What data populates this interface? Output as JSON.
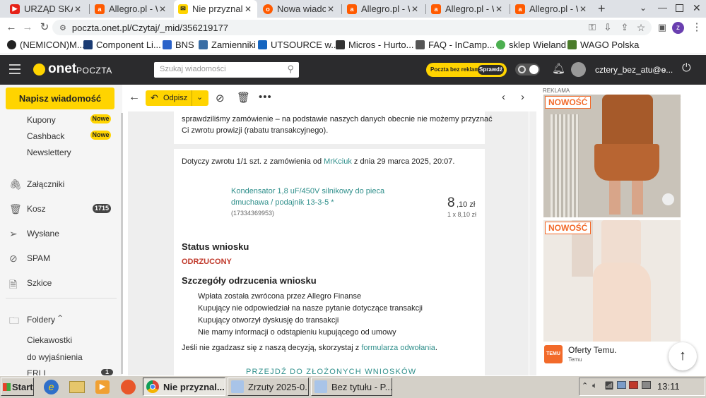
{
  "browser": {
    "tabs": [
      {
        "title": "URZĄD SKARB",
        "icon": "youtube-icon",
        "color": "#e62117"
      },
      {
        "title": "Allegro.pl - W",
        "icon": "allegro-icon",
        "color": "#ff5a00"
      },
      {
        "title": "Nie przyznaliś",
        "icon": "onet-mail-icon",
        "color": "#ffd400",
        "active": true
      },
      {
        "title": "Nowa wiadom",
        "icon": "mail-icon",
        "color": "#ff5a00"
      },
      {
        "title": "Allegro.pl - W",
        "icon": "allegro-icon",
        "color": "#ff5a00"
      },
      {
        "title": "Allegro.pl - W",
        "icon": "allegro-icon",
        "color": "#ff5a00"
      },
      {
        "title": "Allegro.pl - W",
        "icon": "allegro-icon",
        "color": "#ff5a00"
      }
    ],
    "new_tab": "+",
    "url": "poczta.onet.pl/Czytaj/_mid/356219177",
    "profile_letter": "z",
    "bookmarks": [
      {
        "label": "(NEMICON)M...",
        "color": "#222222"
      },
      {
        "label": "Component Li...",
        "color": "#1a3b73"
      },
      {
        "label": "BNS",
        "color": "#2a62c9"
      },
      {
        "label": "Zamienniki",
        "color": "#3a6ea5"
      },
      {
        "label": "UTSOURCE w...",
        "color": "#1565c0"
      },
      {
        "label": "Micros - Hurto...",
        "color": "#333333"
      },
      {
        "label": "FAQ - InCamp...",
        "color": "#555555"
      },
      {
        "label": "sklep Wieland",
        "color": "#4caf50"
      },
      {
        "label": "WAGO Polska",
        "color": "#4a7c2a"
      }
    ]
  },
  "onet": {
    "logo": "onet",
    "logo_section": "POCZTA",
    "search_placeholder": "Szukaj wiadomości",
    "promo_text": "Poczta bez reklam",
    "promo_button": "Sprawdź",
    "username": "cztery_bez_atu@o..."
  },
  "sidebar": {
    "compose": "Napisz wiadomość",
    "items": [
      {
        "label": "Kupony",
        "badge": "Nowe"
      },
      {
        "label": "Cashback",
        "badge": "Nowe"
      },
      {
        "label": "Newslettery"
      },
      {
        "label": "Załączniki",
        "icon": "paperclip-icon"
      },
      {
        "label": "Kosz",
        "icon": "trash-icon",
        "count": "1715"
      },
      {
        "label": "Wysłane",
        "icon": "send-icon"
      },
      {
        "label": "SPAM",
        "icon": "spam-icon"
      },
      {
        "label": "Szkice",
        "icon": "draft-icon"
      },
      {
        "label": "Foldery",
        "icon": "folder-icon"
      },
      {
        "label": "Ciekawostki"
      },
      {
        "label": "do wyjaśnienia"
      },
      {
        "label": "ERLI",
        "count": "1"
      }
    ]
  },
  "toolbar": {
    "reply": "Odpisz"
  },
  "message": {
    "intro_line1": "sprawdziliśmy zamówienie – na podstawie naszych danych obecnie nie możemy przyznać",
    "intro_line2": "Ci zwrotu prowizji (rabatu transakcyjnego).",
    "concerns_prefix": "Dotyczy zwrotu 1/1 szt. z zamówienia od ",
    "seller": "MrKciuk",
    "concerns_suffix": " z dnia 29 marca 2025, 20:07.",
    "product_line1": "Kondensator 1,8 uF/450V silnikowy do pieca",
    "product_line2": "dmuchawa / podajnik 13-3-5 *",
    "product_id": "(17334369953)",
    "price_int": "8",
    "price_dec": ",10 zł",
    "price_qty": "1 x 8,10 zł",
    "status_heading": "Status wniosku",
    "status_value": "ODRZUCONY",
    "details_heading": "Szczegóły odrzucenia wniosku",
    "reasons": [
      "Wpłata została zwrócona przez Allegro Finanse",
      "Kupujący nie odpowiedział na nasze pytanie dotyczące transakcji",
      "Kupujący otworzył dyskusję do transakcji",
      "Nie mamy informacji o odstąpieniu kupującego od umowy"
    ],
    "appeal_prefix": "Jeśli nie zgadzasz się z naszą decyzją, skorzystaj z ",
    "appeal_link": "formularza odwołania",
    "appeal_suffix": ".",
    "cta": "PRZEJDŹ DO ZŁOŻONYCH WNIOSKÓW"
  },
  "ads": {
    "label": "REKLAMA",
    "badge": "NOWOŚĆ",
    "title": "Oferty Temu.",
    "source": "Temu",
    "logo_text": "TEMU"
  },
  "taskbar": {
    "start": "Start",
    "tasks": [
      {
        "label": "Nie przyznal...",
        "active": true
      },
      {
        "label": "Zrzuty 2025-0..."
      },
      {
        "label": "Bez tytułu - P..."
      }
    ],
    "clock": "13:11"
  },
  "colors": {
    "accent": "#ffd400",
    "header": "#2b2b2d",
    "link": "#2f8f8b",
    "reject": "#c0392b"
  }
}
